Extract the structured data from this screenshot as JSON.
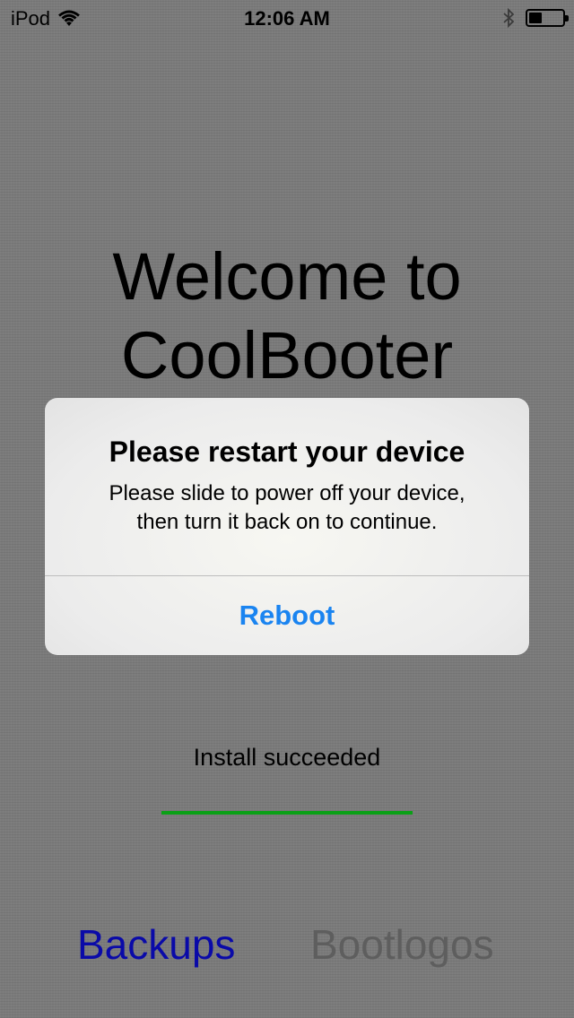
{
  "status_bar": {
    "carrier": "iPod",
    "time": "12:06 AM",
    "wifi_icon": "wifi-icon",
    "bluetooth_icon": "bluetooth-icon",
    "battery_icon": "battery-icon",
    "battery_level": 0.4
  },
  "main": {
    "welcome_line1": "Welcome to",
    "welcome_line2": "CoolBooter",
    "install_status": "Install succeeded",
    "progress": 1.0,
    "progress_color": "#0aa016"
  },
  "alert": {
    "title": "Please restart your device",
    "message_line1": "Please slide to power off your device,",
    "message_line2": "then turn it back on to continue.",
    "button_label": "Reboot",
    "button_color": "#1a84f0"
  },
  "bottom_tabs": {
    "backups_label": "Backups",
    "bootlogos_label": "Bootlogos",
    "active_color": "#0a0aa8",
    "inactive_color": "#5e5e5e"
  }
}
